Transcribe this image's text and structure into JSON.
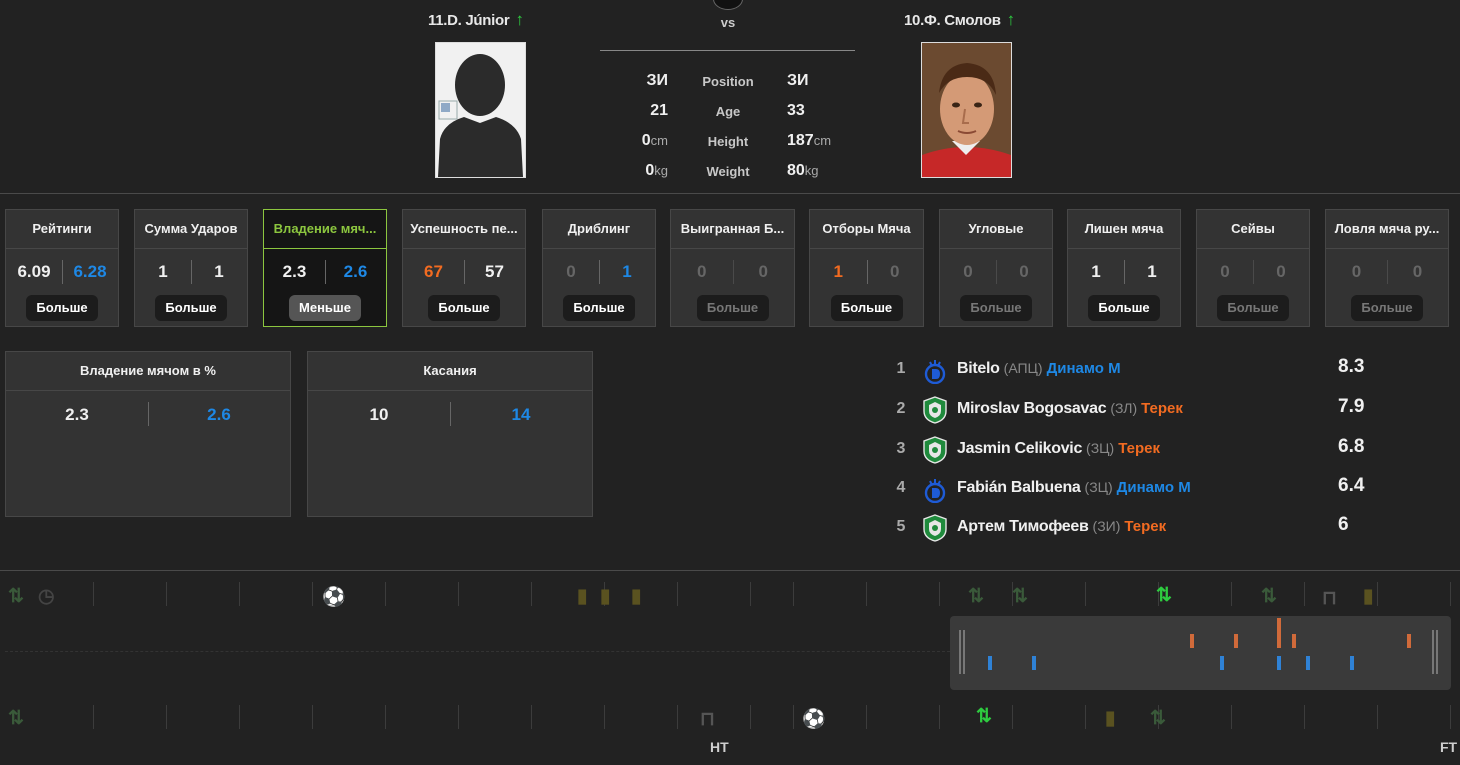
{
  "header": {
    "vs_label": "vs",
    "left_player": {
      "name": "11.D. Júnior",
      "arrow": "↑"
    },
    "right_player": {
      "name": "10.Ф. Смолов",
      "arrow": "↑"
    },
    "comparison": [
      {
        "label": "Position",
        "left": "ЗИ",
        "right": "ЗИ",
        "unit": ""
      },
      {
        "label": "Age",
        "left": "21",
        "right": "33",
        "unit": ""
      },
      {
        "label": "Height",
        "left": "0",
        "right": "187",
        "unit": "cm"
      },
      {
        "label": "Weight",
        "left": "0",
        "right": "80",
        "unit": "kg"
      }
    ]
  },
  "stat_cards": [
    {
      "title": "Рейтинги",
      "left": "6.09",
      "right": "6.28",
      "left_color": "white",
      "right_color": "blue",
      "button": "Больше",
      "state": "normal"
    },
    {
      "title": "Сумма Ударов",
      "left": "1",
      "right": "1",
      "left_color": "white",
      "right_color": "white",
      "button": "Больше",
      "state": "normal"
    },
    {
      "title": "Владение мяч...",
      "left": "2.3",
      "right": "2.6",
      "left_color": "white",
      "right_color": "blue",
      "button": "Меньше",
      "state": "active"
    },
    {
      "title": "Успешность пе...",
      "left": "67",
      "right": "57",
      "left_color": "orange",
      "right_color": "white",
      "button": "Больше",
      "state": "normal"
    },
    {
      "title": "Дриблинг",
      "left": "0",
      "right": "1",
      "left_color": "dim",
      "right_color": "blue",
      "button": "Больше",
      "state": "normal"
    },
    {
      "title": "Выигранная Б...",
      "left": "0",
      "right": "0",
      "left_color": "dim",
      "right_color": "dim",
      "button": "Больше",
      "state": "disabled"
    },
    {
      "title": "Отборы Мяча",
      "left": "1",
      "right": "0",
      "left_color": "orange",
      "right_color": "dim",
      "button": "Больше",
      "state": "normal"
    },
    {
      "title": "Угловые",
      "left": "0",
      "right": "0",
      "left_color": "dim",
      "right_color": "dim",
      "button": "Больше",
      "state": "disabled"
    },
    {
      "title": "Лишен мяча",
      "left": "1",
      "right": "1",
      "left_color": "white",
      "right_color": "white",
      "button": "Больше",
      "state": "normal"
    },
    {
      "title": "Сейвы",
      "left": "0",
      "right": "0",
      "left_color": "dim",
      "right_color": "dim",
      "button": "Больше",
      "state": "disabled"
    },
    {
      "title": "Ловля мяча ру...",
      "left": "0",
      "right": "0",
      "left_color": "dim",
      "right_color": "dim",
      "button": "Больше",
      "state": "disabled"
    }
  ],
  "detail_panels": [
    {
      "title": "Владение мячом в %",
      "left": "2.3",
      "right": "2.6"
    },
    {
      "title": "Касания",
      "left": "10",
      "right": "14"
    }
  ],
  "top_players": [
    {
      "rank": "1",
      "name": "Bitelo",
      "position": "(АПЦ)",
      "team": "Динамо М",
      "team_color": "#1e88e5",
      "rating": "8.3",
      "logo": "dinamo-logo"
    },
    {
      "rank": "2",
      "name": "Miroslav Bogosavac",
      "position": "(ЗЛ)",
      "team": "Терек",
      "team_color": "#f26b21",
      "rating": "7.9",
      "logo": "terek-logo"
    },
    {
      "rank": "3",
      "name": "Jasmin Celikovic",
      "position": "(ЗЦ)",
      "team": "Терек",
      "team_color": "#f26b21",
      "rating": "6.8",
      "logo": "terek-logo"
    },
    {
      "rank": "4",
      "name": "Fabián Balbuena",
      "position": "(ЗЦ)",
      "team": "Динамо М",
      "team_color": "#1e88e5",
      "rating": "6.4",
      "logo": "dinamo-logo"
    },
    {
      "rank": "5",
      "name": "Артем Тимофеев",
      "position": "(ЗИ)",
      "team": "Терек",
      "team_color": "#f26b21",
      "rating": "6",
      "logo": "terek-logo"
    }
  ],
  "timeline": {
    "ht_label": "HT",
    "ft_label": "FT"
  }
}
